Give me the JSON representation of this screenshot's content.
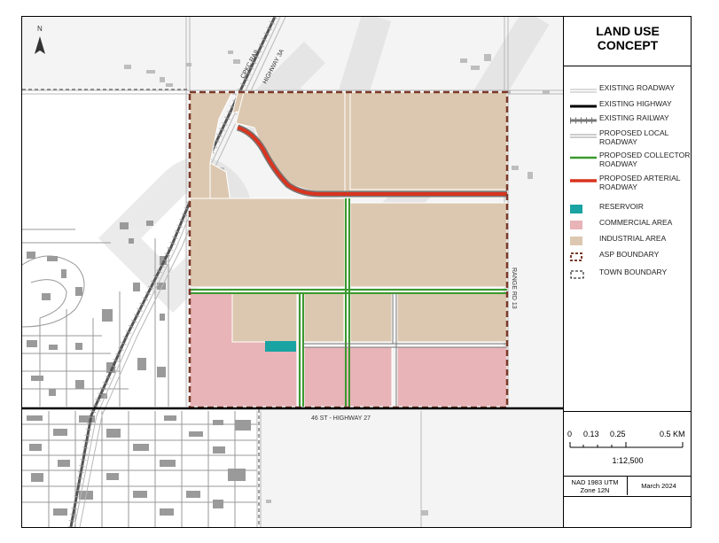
{
  "title": {
    "line1": "LAND USE",
    "line2": "CONCEPT"
  },
  "map_labels": {
    "rail": "CPKC RAIL",
    "highway_3a": "HIGHWAY 3A",
    "range_rd": "RANGE RD 13",
    "highway_27": "46 ST - HIGHWAY 27",
    "north": "N"
  },
  "legend": [
    {
      "id": "existing-roadway",
      "symbol": "line-gray",
      "label": "EXISTING ROADWAY"
    },
    {
      "id": "existing-highway",
      "symbol": "line-black",
      "label": "EXISTING HIGHWAY"
    },
    {
      "id": "existing-railway",
      "symbol": "line-rail",
      "label": "EXISTING RAILWAY"
    },
    {
      "id": "proposed-local",
      "symbol": "line-thin",
      "label": "PROPOSED LOCAL ROADWAY"
    },
    {
      "id": "proposed-collector",
      "symbol": "line-green",
      "label": "PROPOSED COLLECTOR ROADWAY"
    },
    {
      "id": "proposed-arterial",
      "symbol": "line-red",
      "label": "PROPOSED ARTERIAL ROADWAY"
    },
    {
      "id": "reservoir",
      "symbol": "fill-teal",
      "label": "RESERVOIR"
    },
    {
      "id": "commercial",
      "symbol": "fill-pink",
      "label": "COMMERCIAL AREA"
    },
    {
      "id": "industrial",
      "symbol": "fill-tan",
      "label": "INDUSTRIAL AREA"
    },
    {
      "id": "asp-boundary",
      "symbol": "dash-brown",
      "label": "ASP BOUNDARY"
    },
    {
      "id": "town-boundary",
      "symbol": "dash-black",
      "label": "TOWN BOUNDARY"
    }
  ],
  "scale": {
    "ticks": [
      "0",
      "0.13",
      "0.25",
      "0.5 KM"
    ],
    "ratio": "1:12,500"
  },
  "footer": {
    "projection": "NAD 1983 UTM Zone 12N",
    "date": "March 2024"
  },
  "colors": {
    "industrial": "#dcc8b0",
    "commercial": "#e8b4b8",
    "reservoir": "#1aa3a3",
    "arterial": "#d9341f",
    "collector": "#3a9a2e",
    "asp_boundary": "#7a3a2a",
    "watermark": "#d6d6d6"
  }
}
